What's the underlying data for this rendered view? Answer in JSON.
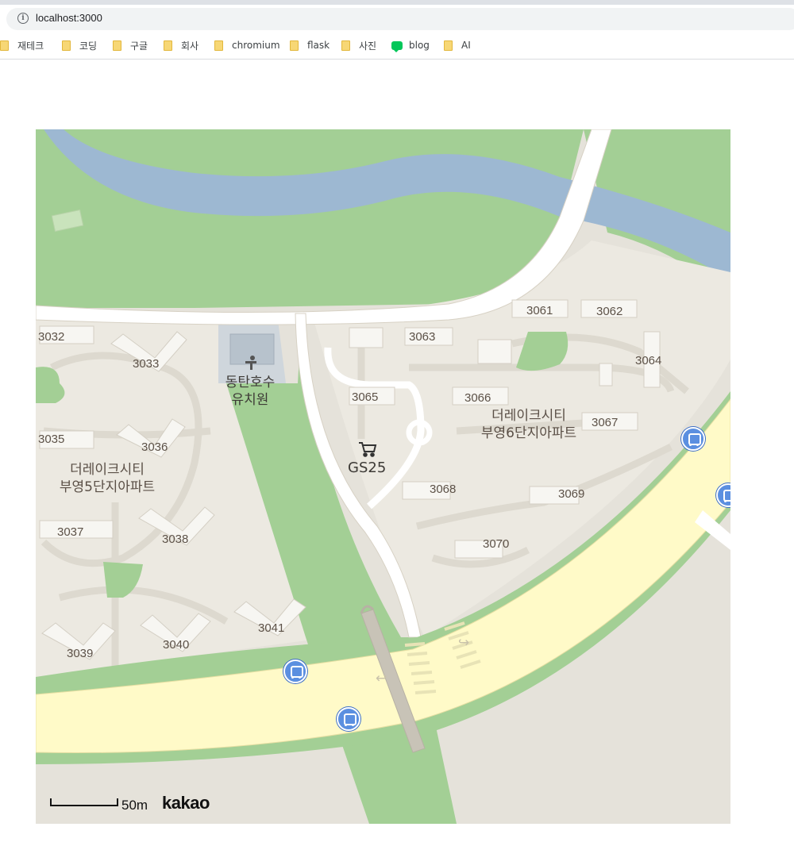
{
  "browser": {
    "url": "localhost:3000",
    "info_icon": "info-icon",
    "bookmarks": [
      {
        "label": "재테크",
        "icon": "folder-icon"
      },
      {
        "label": "코딩",
        "icon": "folder-icon"
      },
      {
        "label": "구글",
        "icon": "folder-icon"
      },
      {
        "label": "회사",
        "icon": "folder-icon"
      },
      {
        "label": "chromium",
        "icon": "folder-icon"
      },
      {
        "label": "flask",
        "icon": "folder-icon"
      },
      {
        "label": "사진",
        "icon": "folder-icon"
      },
      {
        "label": "blog",
        "icon": "blog-icon",
        "icon_text": "blog"
      },
      {
        "label": "AI",
        "icon": "folder-icon"
      }
    ]
  },
  "map": {
    "buildings": {
      "b3032": "3032",
      "b3033": "3033",
      "b3035": "3035",
      "b3036": "3036",
      "b3037": "3037",
      "b3038": "3038",
      "b3039": "3039",
      "b3040": "3040",
      "b3041": "3041",
      "b3061": "3061",
      "b3062": "3062",
      "b3063": "3063",
      "b3064": "3064",
      "b3065": "3065",
      "b3066": "3066",
      "b3067": "3067",
      "b3068": "3068",
      "b3069": "3069",
      "b3070": "3070"
    },
    "area_left_line1": "더레이크시티",
    "area_left_line2": "부영5단지아파트",
    "area_right_line1": "더레이크시티",
    "area_right_line2": "부영6단지아파트",
    "kindergarten_line1": "동탄호수",
    "kindergarten_line2": "유치원",
    "store": "GS25",
    "scale_label": "50m",
    "logo": "kakao",
    "colors": {
      "water": "#9db8d2",
      "park": "#a3cf95",
      "main_road": "#fffac8",
      "road": "#ffffff",
      "ground": "#e5e2da",
      "complex": "#ece9e1",
      "bus_stop": "#5b8fe0"
    }
  }
}
